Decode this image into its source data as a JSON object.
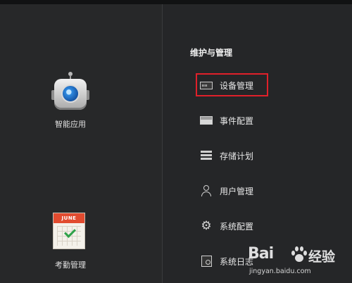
{
  "left_apps": [
    {
      "label": "智能应用",
      "icon": "robot-icon"
    },
    {
      "label": "考勤管理",
      "icon": "calendar-icon",
      "calendar_month": "JUNE"
    }
  ],
  "maintenance": {
    "title": "维护与管理",
    "items": [
      {
        "label": "设备管理",
        "icon": "device-icon",
        "highlighted": true
      },
      {
        "label": "事件配置",
        "icon": "event-icon"
      },
      {
        "label": "存储计划",
        "icon": "storage-icon"
      },
      {
        "label": "用户管理",
        "icon": "user-icon"
      },
      {
        "label": "系统配置",
        "icon": "gear-icon"
      },
      {
        "label": "系统日志",
        "icon": "log-icon"
      }
    ]
  },
  "watermark": {
    "brand": "Bai",
    "brand_suffix": "经验",
    "url": "jingyan.baidu.com"
  },
  "colors": {
    "background": "#222325",
    "highlight_border": "#e0202a"
  }
}
